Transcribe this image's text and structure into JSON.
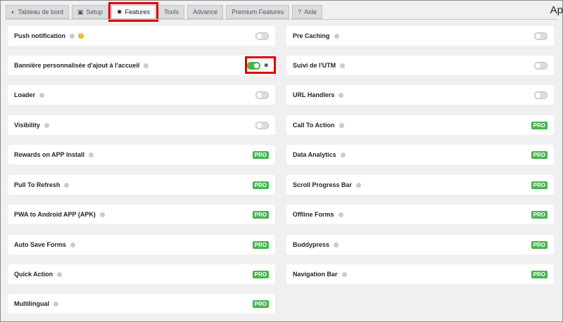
{
  "tabs": [
    {
      "label": "Tableau de bord",
      "icon": "dashboard-icon",
      "glyph": "◐"
    },
    {
      "label": "Setup",
      "icon": "setup-icon",
      "glyph": "▣"
    },
    {
      "label": "Features",
      "icon": "gear-icon",
      "glyph": "✸"
    },
    {
      "label": "Tools",
      "icon": "",
      "glyph": ""
    },
    {
      "label": "Advance",
      "icon": "",
      "glyph": ""
    },
    {
      "label": "Premium Features",
      "icon": "",
      "glyph": ""
    },
    {
      "label": "Aide",
      "icon": "help-icon",
      "glyph": "?"
    }
  ],
  "header": {
    "title_partial": "Ap"
  },
  "pro_label": "PRO",
  "features_left": [
    {
      "name": "Push notification",
      "control": "toggle",
      "state": "off",
      "warning": true
    },
    {
      "name": "Bannière personnalisée d'ajout à l'accueil",
      "control": "toggle",
      "state": "on",
      "settings": true
    },
    {
      "name": "Loader",
      "control": "toggle",
      "state": "off"
    },
    {
      "name": "Visibility",
      "control": "toggle",
      "state": "off"
    },
    {
      "name": "Rewards on APP Install",
      "control": "pro"
    },
    {
      "name": "Pull To Refresh",
      "control": "pro"
    },
    {
      "name": "PWA to Android APP (APK)",
      "control": "pro"
    },
    {
      "name": "Auto Save Forms",
      "control": "pro"
    },
    {
      "name": "Quick Action",
      "control": "pro"
    },
    {
      "name": "Multilingual",
      "control": "pro"
    }
  ],
  "features_right": [
    {
      "name": "Pre Caching",
      "control": "toggle",
      "state": "off"
    },
    {
      "name": "Suivi de l'UTM",
      "control": "toggle",
      "state": "off"
    },
    {
      "name": "URL Handlers",
      "control": "toggle",
      "state": "off"
    },
    {
      "name": "Call To Action",
      "control": "pro"
    },
    {
      "name": "Data Analytics",
      "control": "pro"
    },
    {
      "name": "Scroll Progress Bar",
      "control": "pro"
    },
    {
      "name": "Offline Forms",
      "control": "pro"
    },
    {
      "name": "Buddypress",
      "control": "pro"
    },
    {
      "name": "Navigation Bar",
      "control": "pro"
    }
  ],
  "colors": {
    "accent_green": "#46b450",
    "highlight_red": "#e00000",
    "warning": "#f0b429"
  }
}
